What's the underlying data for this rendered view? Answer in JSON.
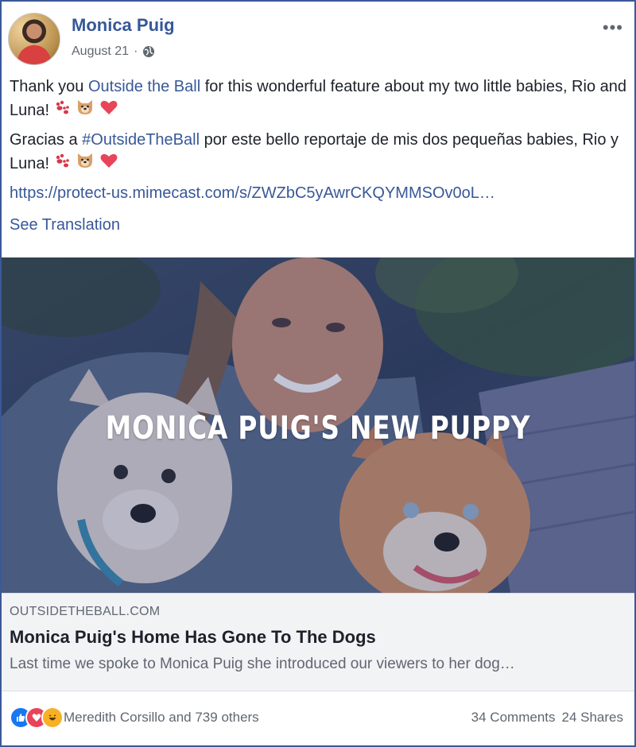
{
  "post": {
    "author": "Monica Puig",
    "date": "August 21",
    "separator": "·",
    "more": "•••",
    "paragraph1": {
      "before": "Thank you ",
      "link": "Outside the Ball",
      "after": " for this wonderful feature about my two little babies, Rio and Luna! "
    },
    "paragraph2": {
      "before": "Gracias a ",
      "hashtag": "#OutsideTheBall",
      "after": " por este bello reportaje de mis dos pequeñas babies, Rio y Luna! "
    },
    "url": "https://protect-us.mimecast.com/s/ZWZbC5yAwrCKQYMMSOv0oL…",
    "see_translation": "See Translation",
    "emojis": [
      "paw-prints-icon",
      "dog-face-icon",
      "red-heart-icon"
    ]
  },
  "photo": {
    "overlay_title": "MONICA PUIG'S NEW PUPPY"
  },
  "link_preview": {
    "domain": "OUTSIDETHEBALL.COM",
    "title": "Monica Puig's Home Has Gone To The Dogs",
    "description": "Last time we spoke to Monica Puig she introduced our viewers to her dog…"
  },
  "footer": {
    "reactions": [
      "like-icon",
      "love-icon",
      "haha-icon"
    ],
    "reacted_by": "Meredith Corsillo and 739 others",
    "comments": "34 Comments",
    "shares": "24 Shares"
  },
  "colors": {
    "link": "#385898",
    "name": "#365899",
    "border": "#3b5998",
    "like": "#1877f2",
    "love": "#e9435a",
    "haha": "#f7b125"
  }
}
